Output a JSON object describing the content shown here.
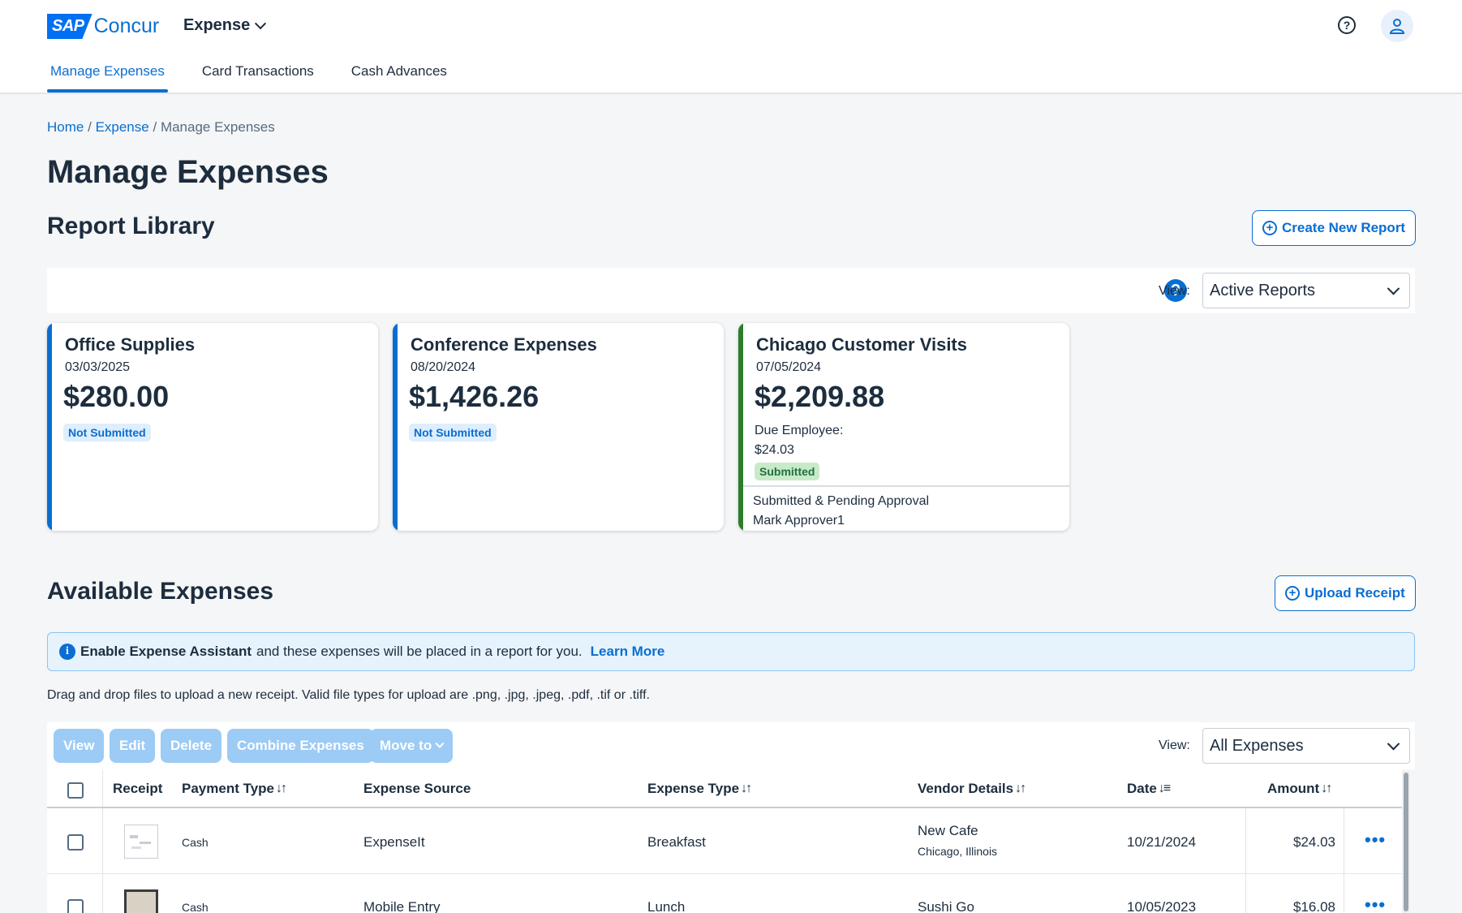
{
  "app": {
    "logo_sap": "SAP",
    "logo_concur": "Concur",
    "product_menu": "Expense"
  },
  "tabs": [
    {
      "label": "Manage Expenses",
      "active": true
    },
    {
      "label": "Card Transactions",
      "active": false
    },
    {
      "label": "Cash Advances",
      "active": false
    }
  ],
  "breadcrumb": {
    "home": "Home",
    "sep1": "/",
    "expense": "Expense",
    "sep2": "/",
    "current": "Manage Expenses"
  },
  "page_title": "Manage Expenses",
  "report_library": {
    "title": "Report Library",
    "create_button": "Create New Report",
    "view_label": "View:",
    "view_value": "Active Reports",
    "reports": [
      {
        "title": "Office Supplies",
        "date": "03/03/2025",
        "amount": "$280.00",
        "status": "Not Submitted",
        "stripe_color": "#0a6ed1"
      },
      {
        "title": "Conference Expenses",
        "date": "08/20/2024",
        "amount": "$1,426.26",
        "status": "Not Submitted",
        "stripe_color": "#0a6ed1"
      },
      {
        "title": "Chicago Customer Visits",
        "date": "07/05/2024",
        "amount": "$2,209.88",
        "due_label": "Due Employee:",
        "due_amount": "$24.03",
        "status": "Submitted",
        "footer_line1": "Submitted & Pending Approval",
        "footer_line2": "Mark Approver1",
        "stripe_color": "#2b7d2b"
      }
    ]
  },
  "available_expenses": {
    "title": "Available Expenses",
    "upload_button": "Upload Receipt",
    "info_bold": "Enable Expense Assistant",
    "info_text": "and these expenses will be placed in a report for you.",
    "info_link": "Learn More",
    "drop_text": "Drag and drop files to upload a new receipt. Valid file types for upload are .png, .jpg, .jpeg, .pdf, .tif or .tiff.",
    "toolbar": {
      "view": "View",
      "edit": "Edit",
      "delete": "Delete",
      "combine": "Combine Expenses",
      "move": "Move to"
    },
    "view_label": "View:",
    "view_value": "All Expenses",
    "columns": {
      "receipt": "Receipt",
      "payment_type": "Payment Type",
      "expense_source": "Expense Source",
      "expense_type": "Expense Type",
      "vendor": "Vendor Details",
      "date": "Date",
      "amount": "Amount"
    },
    "rows": [
      {
        "payment": "Cash",
        "source": "ExpenseIt",
        "type": "Breakfast",
        "vendor": "New Cafe",
        "location": "Chicago, Illinois",
        "date": "10/21/2024",
        "amount": "$24.03"
      },
      {
        "payment": "Cash",
        "source": "Mobile Entry",
        "type": "Lunch",
        "vendor": "Sushi Go",
        "location": "",
        "date": "10/05/2023",
        "amount": "$16.08"
      }
    ],
    "more_glyph": "•••"
  }
}
